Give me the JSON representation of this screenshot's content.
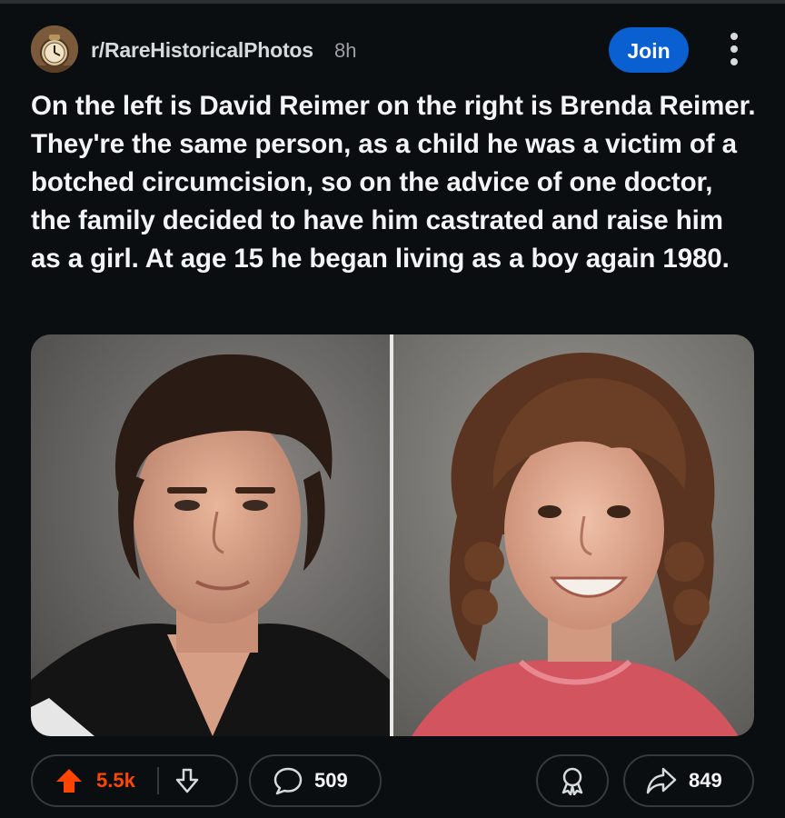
{
  "post": {
    "subreddit": "r/RareHistoricalPhotos",
    "time_ago": "8h",
    "join_label": "Join",
    "title": "On the left is David Reimer on the right is Brenda Reimer. They're the same person, as a child he was a victim of a botched circumcision, so on the advice of one doctor, the family decided to have him castrated and raise him as a girl. At age 15 he began living as a boy again 1980."
  },
  "media": {
    "images": [
      {
        "subject": "teenage-boy-portrait"
      },
      {
        "subject": "young-girl-portrait"
      }
    ]
  },
  "actions": {
    "score": "5.5k",
    "comments": "509",
    "shares": "849"
  },
  "colors": {
    "background": "#0b0e11",
    "join_button": "#0a5fd1",
    "upvote": "#ff4500",
    "pill_border": "#343a40"
  },
  "icons": [
    "subreddit-avatar-icon",
    "more-options-icon",
    "upvote-icon",
    "downvote-icon",
    "comment-icon",
    "award-icon",
    "share-icon"
  ]
}
